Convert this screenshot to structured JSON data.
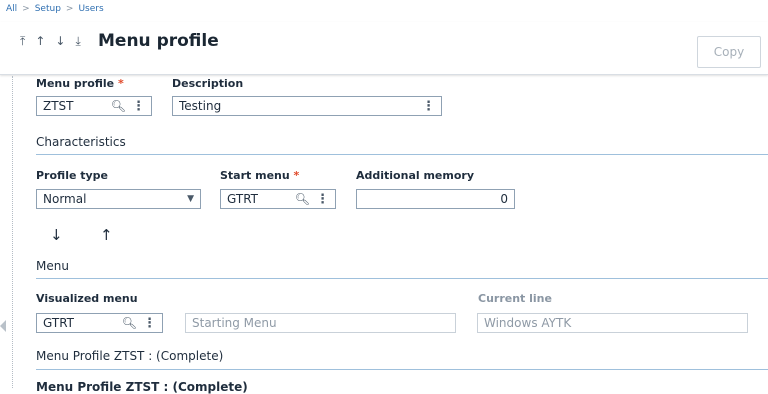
{
  "breadcrumb": [
    "All",
    "Setup",
    "Users"
  ],
  "header": {
    "title": "Menu profile",
    "copy_label": "Copy",
    "nav_icons": [
      "first-icon",
      "previous-icon",
      "next-icon",
      "last-icon"
    ]
  },
  "form": {
    "menu_profile": {
      "label": "Menu profile",
      "value": "ZTST"
    },
    "description": {
      "label": "Description",
      "value": "Testing"
    },
    "characteristics_title": "Characteristics",
    "profile_type": {
      "label": "Profile type",
      "value": "Normal"
    },
    "start_menu": {
      "label": "Start menu",
      "value": "GTRT"
    },
    "additional_memory": {
      "label": "Additional memory",
      "value": "0"
    },
    "menu_title": "Menu",
    "visualized_menu": {
      "label": "Visualized menu",
      "value": "GTRT",
      "description": "Starting Menu"
    },
    "current_line": {
      "label": "Current line",
      "value": "Windows AYTK"
    },
    "tree_title": "Menu Profile ZTST : (Complete)",
    "tree_title_partial": "Menu Profile ZTST : (Complete)"
  },
  "colors": {
    "accent": "#2f6fb1",
    "required": "#e0492a",
    "section_rule": "#9fc0dc"
  }
}
